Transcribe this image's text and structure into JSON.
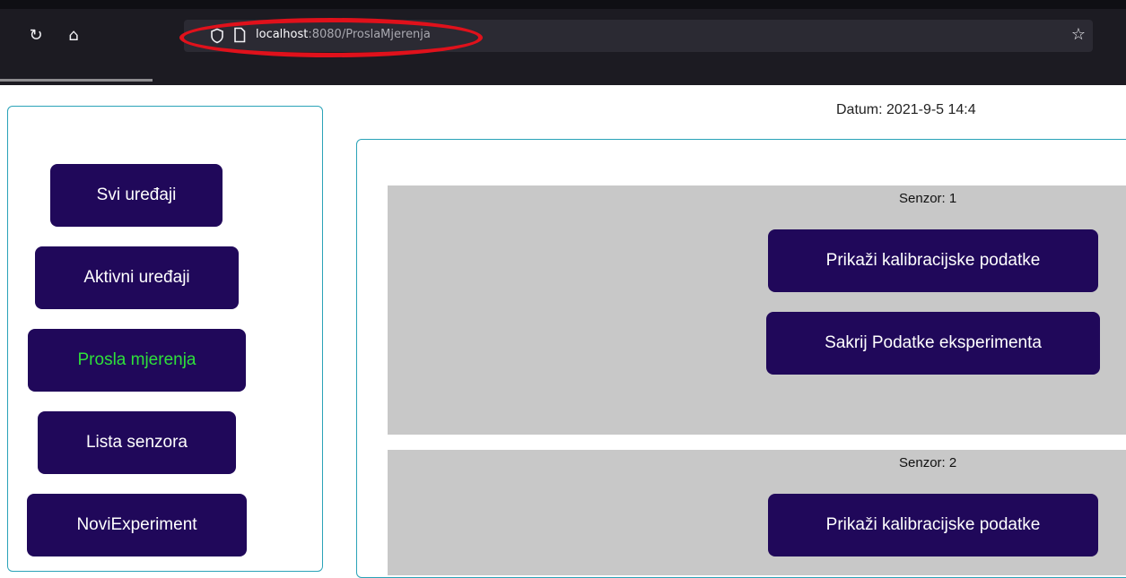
{
  "browser": {
    "url_host": "localhost",
    "url_rest": ":8080/ProslaMjerenja",
    "icons": [
      "reload-icon",
      "home-icon",
      "shield-icon",
      "page-icon",
      "star-icon"
    ]
  },
  "header": {
    "datum": "Datum: 2021-9-5 14:4"
  },
  "sidebar": {
    "items": [
      {
        "label": "Svi uređaji"
      },
      {
        "label": "Aktivni uređaji"
      },
      {
        "label": "Prosla mjerenja"
      },
      {
        "label": "Lista senzora"
      },
      {
        "label": "NoviExperiment"
      }
    ],
    "active_color": "#2ee03a"
  },
  "sensors": [
    {
      "label": "Senzor: 1",
      "buttons": [
        {
          "label": "Prikaži kalibracijske podatke"
        },
        {
          "label": "Sakrij Podatke eksperimenta"
        }
      ]
    },
    {
      "label": "Senzor: 2",
      "buttons": [
        {
          "label": "Prikaži kalibracijske podatke"
        }
      ]
    }
  ],
  "colors": {
    "button_bg": "#20085a",
    "panel_border": "#2aa3b8",
    "card_bg": "#c8c8c8",
    "highlight": "#e0111b"
  }
}
